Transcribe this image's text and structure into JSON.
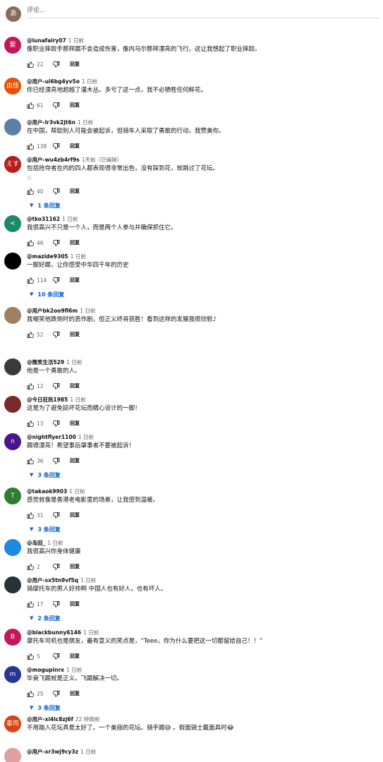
{
  "composer": {
    "avatar_char": "あ",
    "placeholder": "评论..."
  },
  "comments": [
    {
      "avatar": "紫",
      "color": "#c2185b",
      "author": "@lunafairy07",
      "time": "1 日前",
      "text": "像职业摔跤手那样踢不会造成伤害，像内马尔那样漂亮的飞行。这让我想起了职业摔跤。",
      "likes": "22",
      "reply": "回复"
    },
    {
      "avatar": "由佳",
      "color": "#e65100",
      "author": "@用户-ui6bg4yv5o",
      "time": "1 日前",
      "text": "你已经漂亮地超越了灌木丛。多亏了这一点，我不必牺牲任何鲜花。",
      "likes": "61",
      "reply": "回复"
    },
    {
      "avatar": "",
      "color": "#5c7fa8",
      "author": "@用户-lr3vk2jt6n",
      "time": "1 日前",
      "text": "在中国，帮助别人可能会被起诉，但骑车人采取了勇敢的行动。我赞美你。",
      "likes": "138",
      "reply": "回复"
    },
    {
      "avatar": "えす",
      "color": "#b71c1c",
      "author": "@用户-wu4zb4rf9s",
      "time": "1天前（已编辑）",
      "text": "包括抢夺者在内的四人都表现得非常出色，没有踩到花，就跳过了花坛。",
      "emoji": "◎",
      "likes": "40",
      "reply": "回复",
      "replies": "1 条回复"
    },
    {
      "avatar": "<",
      "color": "#1b8a6b",
      "author": "@tko31162",
      "time": "1 日前",
      "text": "我很高兴不只是一个人，而是两个人参与并确保抓住它。",
      "likes": "46",
      "reply": "回复"
    },
    {
      "avatar": "",
      "color": "#000000",
      "author": "@mazide9305",
      "time": "1 日前",
      "text": "一脚好踢，让你感受中华四千年的历史",
      "likes": "114",
      "reply": "回复",
      "replies": "10 条回复"
    },
    {
      "avatar": "",
      "color": "#a08060",
      "author": "@用户bk2oo9fl6m",
      "time": "1 日前",
      "text": "我嘲笑他跌倒时的恶作剧，但正义终将获胜！看到这样的发展我很欣慰♪",
      "likes": "52",
      "reply": "回复"
    },
    {
      "avatar": "",
      "color": "#3a3a3a",
      "author": "@微笑生活529",
      "time": "1 日前",
      "text": "他是一个勇敢的人。",
      "likes": "12",
      "reply": "回复"
    },
    {
      "avatar": "",
      "color": "#7a2a2a",
      "author": "@今日狂热1985",
      "time": "1 日前",
      "text": "这是为了避免损坏花坛而精心设计的一脚！",
      "likes": "13",
      "reply": "回复"
    },
    {
      "avatar": "n",
      "color": "#4a148c",
      "author": "@nightflyer1100",
      "time": "1 日前",
      "text": "踢得漂亮！希望事后肇事者不要被起诉！",
      "likes": "36",
      "reply": "回复",
      "replies": "3 条回复"
    },
    {
      "avatar": "T",
      "color": "#2e7d32",
      "author": "@takaok9903",
      "time": "1 日前",
      "text": "感觉就像是香港老电影里的场景，让我感到温暖。",
      "likes": "31",
      "reply": "回复",
      "replies": "3 条回复"
    },
    {
      "avatar": "",
      "color": "#1e88e5",
      "author": "@岛田_",
      "time": "1 日前",
      "text": "我很高兴你身体健康",
      "likes": "2",
      "reply": "回复"
    },
    {
      "avatar": "",
      "color": "#263238",
      "author": "@用户-sx5tn9vf5q",
      "time": "1 日前",
      "text": "骑摩托车的男人好帅啊 中国人也有好人，也有坏人。",
      "likes": "17",
      "reply": "回复",
      "replies": "2 条回复"
    },
    {
      "avatar": "B",
      "color": "#c2185b",
      "author": "@blackbunny6146",
      "time": "1 日前",
      "text": "摩托车司机也是朋友，最有意义的笑点是，“Teee，你为什么要把这一切都留给自己！！”",
      "likes": "5",
      "reply": "回复"
    },
    {
      "avatar": "m",
      "color": "#283593",
      "author": "@mogupinrx",
      "time": "1 日前",
      "text": "毕竟飞踢就是正义。飞踢解决一切。",
      "likes": "25",
      "reply": "回复",
      "replies": "3 条回复"
    },
    {
      "avatar": "泰司",
      "color": "#d84315",
      "author": "@用户-xi4lc8zj6f",
      "time": "22 時間前",
      "text": "不用踏入花坛真是太好了。一个美丽的花坛。骑手踢😅 。假面骑士戴面具时😂",
      "likes": "",
      "reply": ""
    },
    {
      "avatar": "",
      "color": "#e0a0a0",
      "author": "@用户-xr3wj9cy3z",
      "time": "1 日前",
      "text": "",
      "likes": "",
      "reply": ""
    }
  ]
}
